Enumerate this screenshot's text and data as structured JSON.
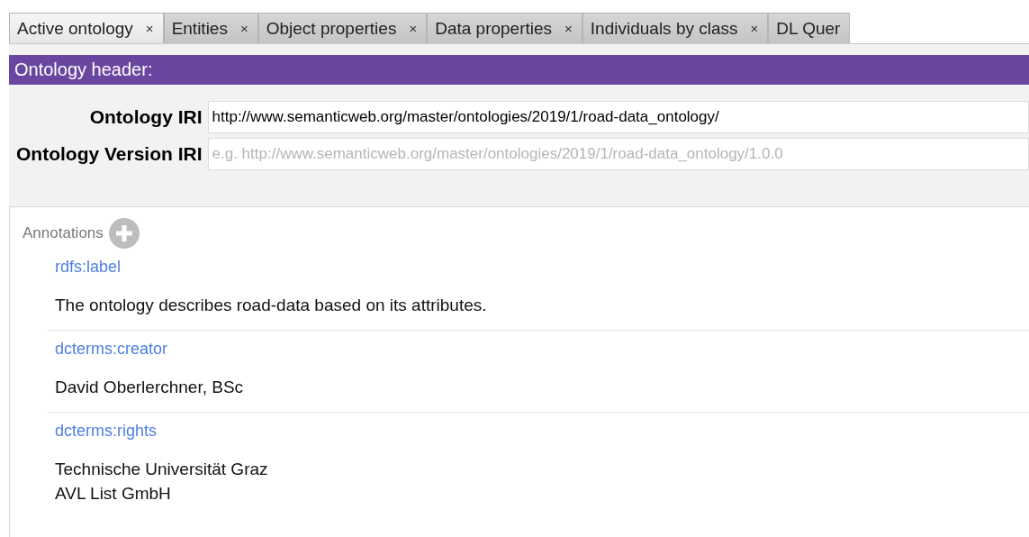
{
  "tabs": [
    {
      "label": "Active ontology",
      "close": "×",
      "selected": true
    },
    {
      "label": "Entities",
      "close": "×",
      "selected": false
    },
    {
      "label": "Object properties",
      "close": "×",
      "selected": false
    },
    {
      "label": "Data properties",
      "close": "×",
      "selected": false
    },
    {
      "label": "Individuals by class",
      "close": "×",
      "selected": false
    },
    {
      "label": "DL Quer",
      "selected": false
    }
  ],
  "header": {
    "title": "Ontology header:"
  },
  "fields": [
    {
      "label": "Ontology IRI",
      "value": "http://www.semanticweb.org/master/ontologies/2019/1/road-data_ontology/"
    },
    {
      "label": "Ontology Version IRI",
      "placeholder": "e.g. http://www.semanticweb.org/master/ontologies/2019/1/road-data_ontology/1.0.0"
    }
  ],
  "annotations": {
    "title": "Annotations",
    "items": [
      {
        "property": "rdfs:label",
        "lines": [
          "The ontology describes road-data based on its attributes."
        ]
      },
      {
        "property": "dcterms:creator",
        "lines": [
          "David Oberlerchner, BSc"
        ]
      },
      {
        "property": "dcterms:rights",
        "lines": [
          "Technische Universität Graz",
          "AVL List GmbH"
        ]
      }
    ]
  }
}
